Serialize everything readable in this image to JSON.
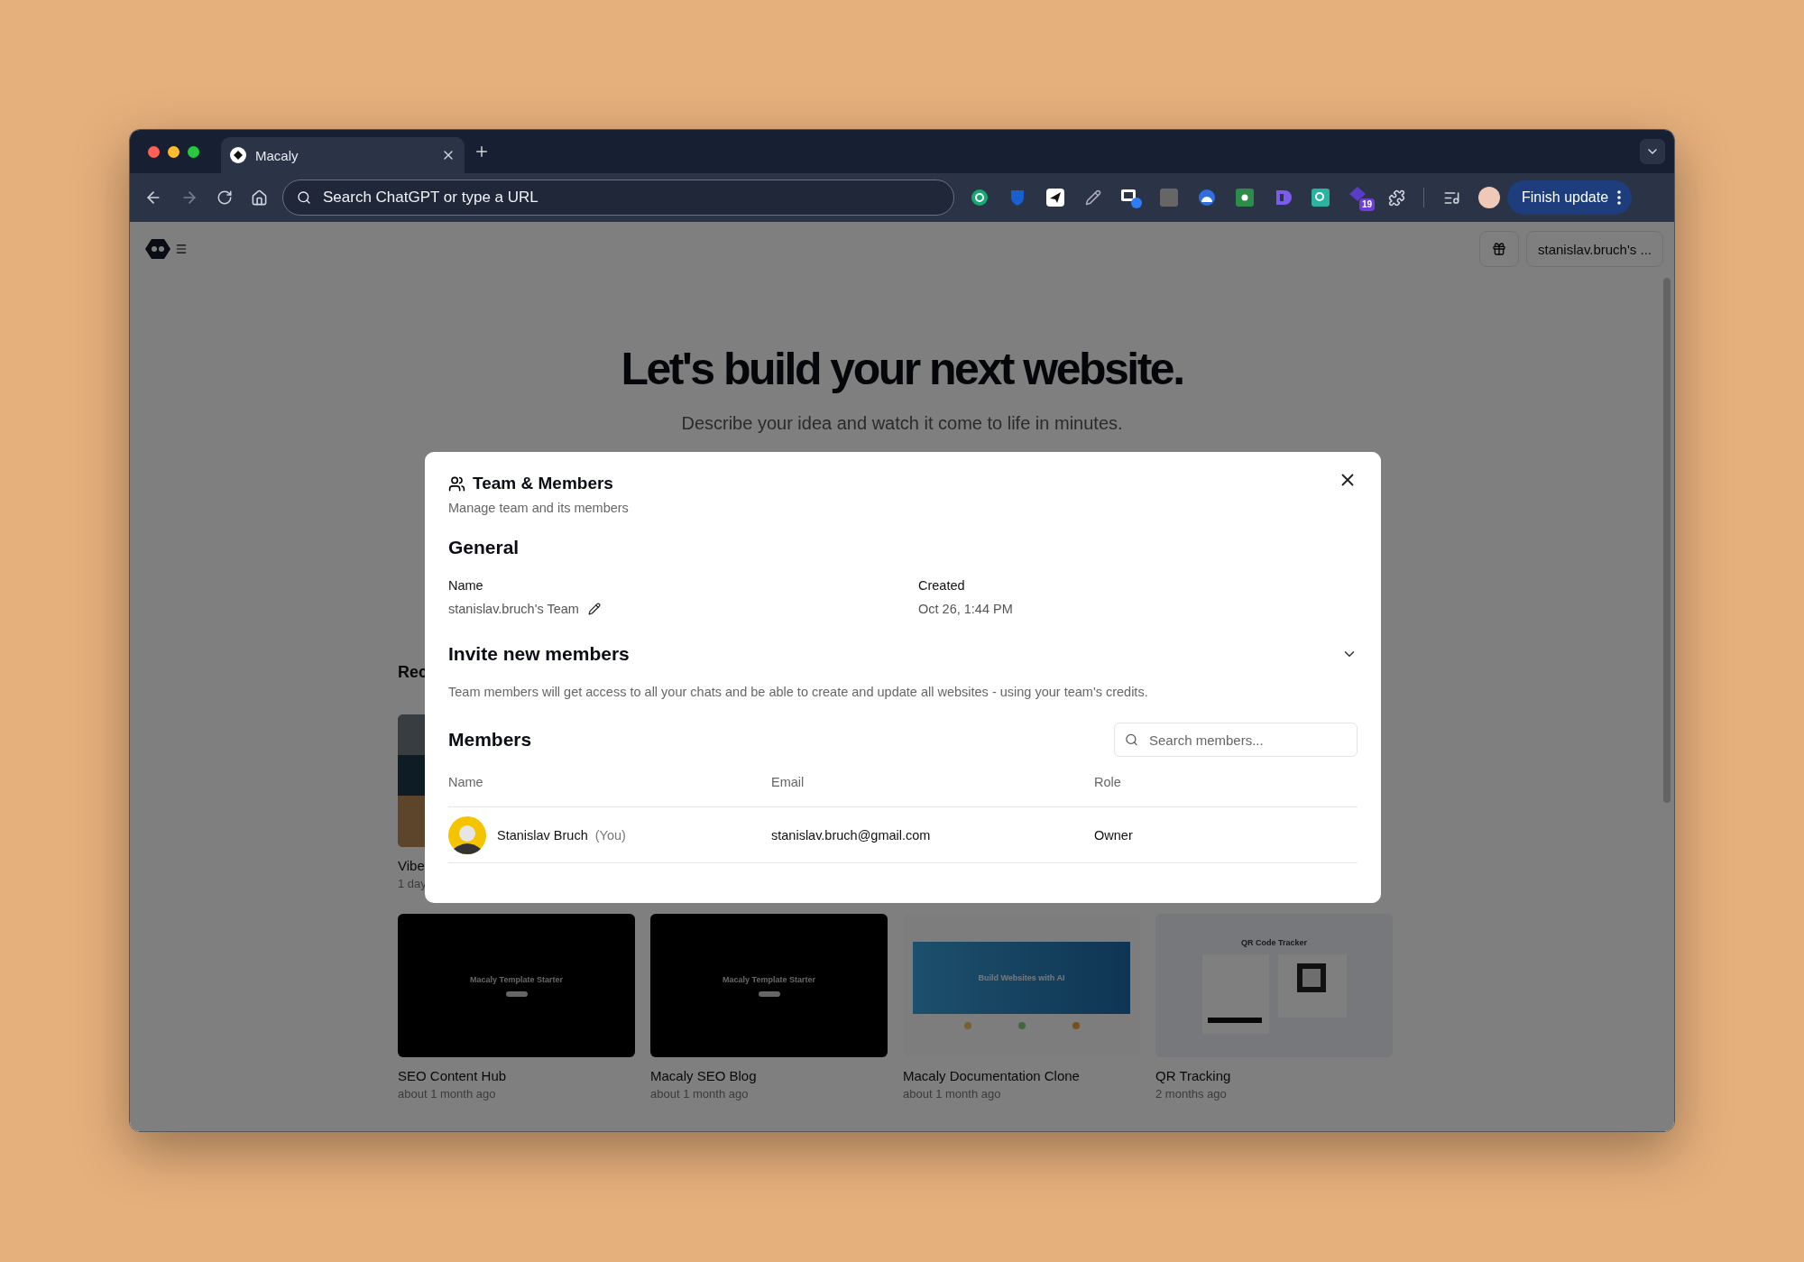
{
  "browser": {
    "tabs": [
      {
        "title": "Macaly",
        "selected": true
      }
    ],
    "address_placeholder": "Search ChatGPT or type a URL",
    "extension_badge": "19",
    "update_button": "Finish update"
  },
  "page": {
    "account_button": "stanislav.bruch's ...",
    "hero": {
      "title": "Let's build your next website.",
      "subtitle": "Describe your idea and watch it come to life in minutes."
    },
    "recent": {
      "heading": "Rec",
      "projects": [
        {
          "kind": "picture",
          "title": "Vibe",
          "time": "1 day"
        },
        {
          "kind": "dark",
          "title": "SEO Content Hub",
          "time": "about 1 month ago",
          "preview_title": "Macaly Template Starter"
        },
        {
          "kind": "dark",
          "title": "Macaly SEO Blog",
          "time": "about 1 month ago",
          "preview_title": "Macaly Template Starter"
        },
        {
          "kind": "hero",
          "title": "Macaly Documentation Clone",
          "time": "about 1 month ago",
          "preview_title": "Build Websites with AI"
        },
        {
          "kind": "qr",
          "title": "QR Tracking",
          "time": "2 months ago",
          "preview_title": "QR Code Tracker"
        }
      ]
    }
  },
  "dialog": {
    "title": "Team & Members",
    "subtitle": "Manage team and its members",
    "general": {
      "heading": "General",
      "fields": [
        {
          "label": "Name",
          "value": "stanislav.bruch's Team",
          "editable": true
        },
        {
          "label": "Created",
          "value": "Oct 26, 1:44 PM",
          "editable": false
        }
      ]
    },
    "invite": {
      "heading": "Invite new members",
      "expanded": false,
      "description": "Team members will get access to all your chats and be able to create and update all websites - using your team's credits."
    },
    "members": {
      "heading": "Members",
      "search_placeholder": "Search members...",
      "columns": [
        "Name",
        "Email",
        "Role"
      ],
      "rows": [
        {
          "name": "Stanislav Bruch",
          "tag": "(You)",
          "email": "stanislav.bruch@gmail.com",
          "role": "Owner"
        }
      ]
    }
  }
}
